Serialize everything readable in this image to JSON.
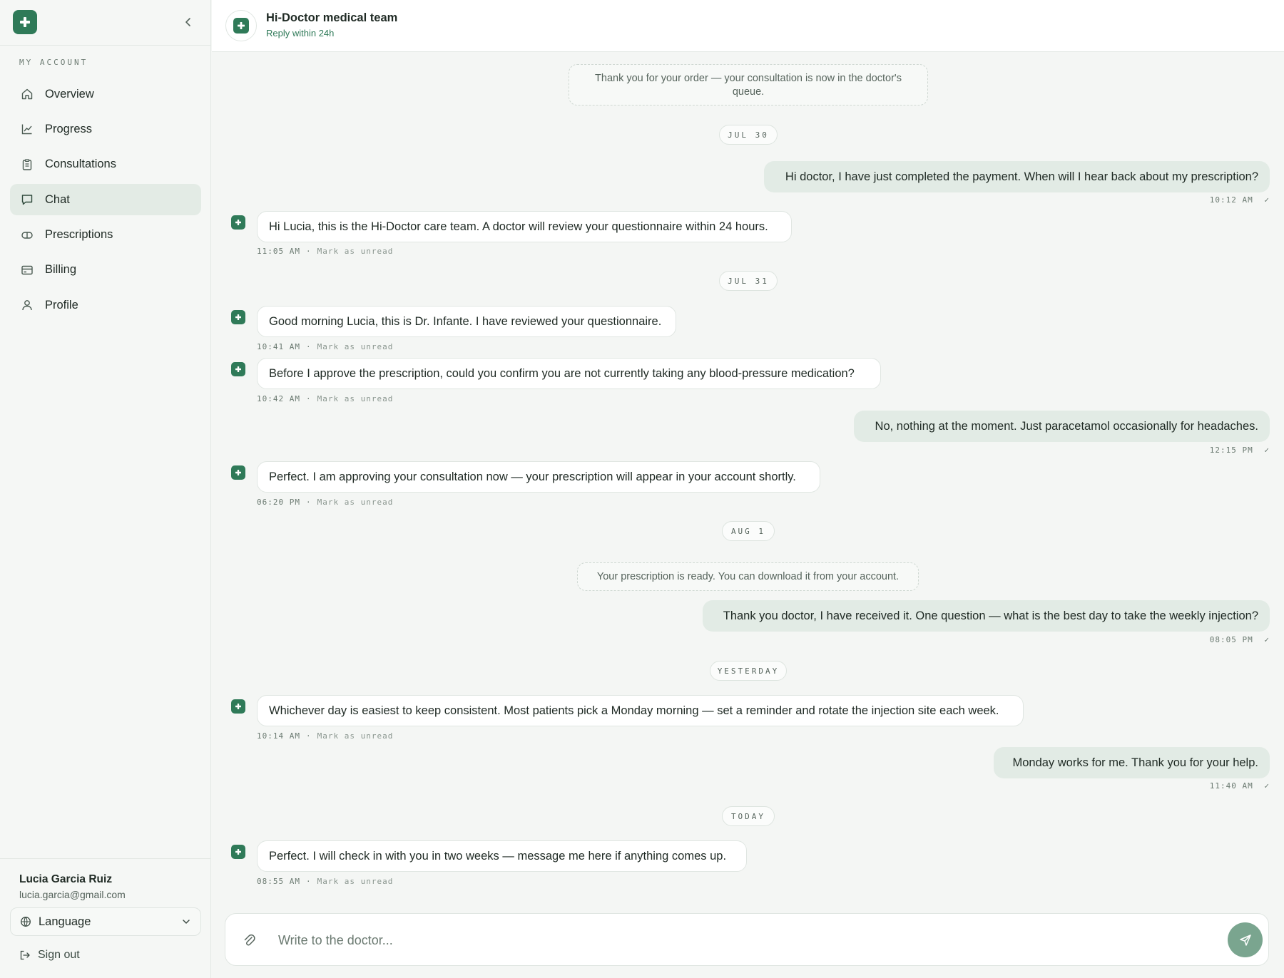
{
  "sidebar": {
    "section_label": "MY ACCOUNT",
    "items": [
      {
        "label": "Overview",
        "icon": "home-icon"
      },
      {
        "label": "Progress",
        "icon": "chart-icon"
      },
      {
        "label": "Consultations",
        "icon": "clipboard-icon"
      },
      {
        "label": "Chat",
        "icon": "chat-icon",
        "active": true
      },
      {
        "label": "Prescriptions",
        "icon": "pill-icon"
      },
      {
        "label": "Billing",
        "icon": "card-icon"
      },
      {
        "label": "Profile",
        "icon": "user-icon"
      }
    ],
    "user": {
      "name": "Lucia Garcia Ruiz",
      "email": "lucia.garcia@gmail.com"
    },
    "language_label": "Language",
    "signout_label": "Sign out"
  },
  "header": {
    "title": "Hi-Doctor medical team",
    "subtitle": "Reply within 24h"
  },
  "feed": {
    "system_1": "Thank you for your order — your consultation is now in the doctor's queue.",
    "date_1": "JUL 30",
    "msg_1": {
      "text": "Hi doctor, I have just completed the payment. When will I hear back about my prescription?",
      "time": "10:12 AM",
      "check": "✓"
    },
    "msg_2": {
      "text": "Hi Lucia, this is the Hi-Doctor care team. A doctor will review your questionnaire within 24 hours.",
      "time": "11:05 AM"
    },
    "date_2": "JUL 31",
    "msg_3": {
      "text": "Good morning Lucia, this is Dr. Infante. I have reviewed your questionnaire.",
      "time": "10:41 AM"
    },
    "msg_4": {
      "text": "Before I approve the prescription, could you confirm you are not currently taking any blood-pressure medication?",
      "time": "10:42 AM"
    },
    "msg_5": {
      "text": "No, nothing at the moment. Just paracetamol occasionally for headaches.",
      "time": "12:15 PM",
      "check": "✓"
    },
    "msg_6": {
      "text": "Perfect. I am approving your consultation now — your prescription will appear in your account shortly.",
      "time": "06:20 PM"
    },
    "date_3": "AUG 1",
    "system_2": "Your prescription is ready. You can download it from your account.",
    "msg_7": {
      "text": "Thank you doctor, I have received it. One question — what is the best day to take the weekly injection?",
      "time": "08:05 PM",
      "check": "✓"
    },
    "date_4": "YESTERDAY",
    "msg_8": {
      "text": "Whichever day is easiest to keep consistent. Most patients pick a Monday morning — set a reminder and rotate the injection site each week.",
      "time": "10:14 AM"
    },
    "msg_9": {
      "text": "Monday works for me. Thank you for your help.",
      "time": "11:40 AM",
      "check": "✓"
    },
    "date_5": "TODAY",
    "msg_10": {
      "text": "Perfect. I will check in with you in two weeks — message me here if anything comes up.",
      "time": "08:55 AM"
    },
    "mark_unread": "Mark as unread",
    "separator": "·"
  },
  "composer": {
    "placeholder": "Write to the doctor..."
  },
  "colors": {
    "accent": "#2f7a58",
    "outgoing_bubble": "#e2ebe5",
    "send_button": "#7aa58f"
  }
}
